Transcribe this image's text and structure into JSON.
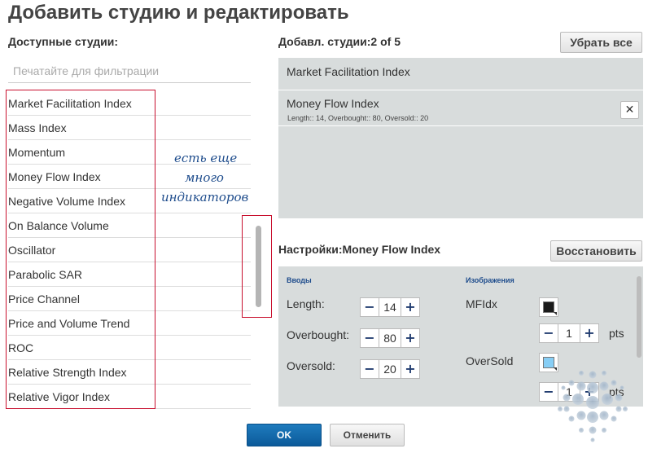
{
  "dialog": {
    "title": "Добавить студию и редактировать"
  },
  "available": {
    "label": "Доступные студии:",
    "filter_placeholder": "Печатайте для фильтрации",
    "items": [
      "Market Facilitation Index",
      "Mass Index",
      "Momentum",
      "Money Flow Index",
      "Negative Volume Index",
      "On Balance Volume",
      "Oscillator",
      "Parabolic SAR",
      "Price Channel",
      "Price and Volume Trend",
      "ROC",
      "Relative Strength Index",
      "Relative Vigor Index"
    ]
  },
  "annotation": {
    "lines": [
      "есть еще",
      "много",
      "индикаторов"
    ],
    "color": "#1e4c8c",
    "highlight_color": "#c8102e"
  },
  "added": {
    "label": "Добавл. студии:2 of 5",
    "remove_all_label": "Убрать все",
    "items": [
      {
        "name": "Market Facilitation Index",
        "params": ""
      },
      {
        "name": "Money Flow Index",
        "params": "Length:: 14, Overbought:: 80, Oversold:: 20",
        "close": "✕"
      }
    ]
  },
  "settings": {
    "label": "Настройки:Money Flow Index",
    "restore_label": "Восстановить",
    "inputs_header": "Вводы",
    "images_header": "Изображения",
    "inputs": [
      {
        "label": "Length:",
        "value": "14"
      },
      {
        "label": "Overbought:",
        "value": "80"
      },
      {
        "label": "Oversold:",
        "value": "20"
      }
    ],
    "images": [
      {
        "label": "MFIdx",
        "color": "#1a1a1a",
        "width": "1",
        "unit": "pts"
      },
      {
        "label": "OverSold",
        "color": "#87cef5",
        "width": "1",
        "unit": "pts"
      }
    ],
    "minus": "−",
    "plus": "+"
  },
  "footer": {
    "ok_label": "OK",
    "cancel_label": "Отменить"
  },
  "colors": {
    "panel_bg": "#d8dcdc",
    "primary_button": "#0b5a9a"
  }
}
